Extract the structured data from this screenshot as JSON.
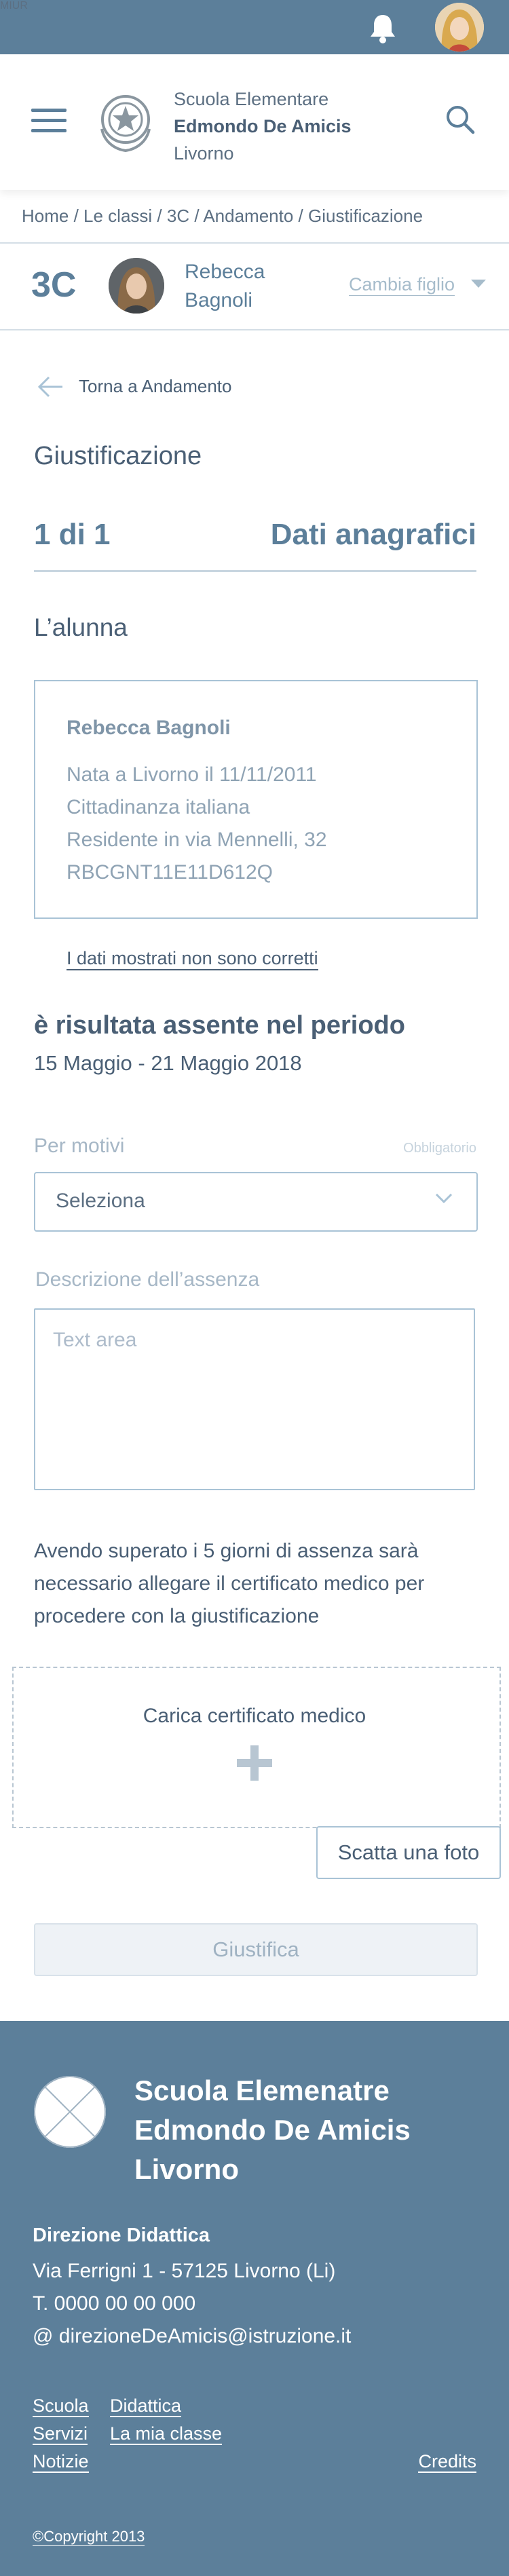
{
  "topbar": {
    "brand": "MIUR",
    "bell_icon": "bell-icon",
    "avatar_icon": "user-avatar"
  },
  "header": {
    "menu_icon": "hamburger-menu-icon",
    "school_line1": "Scuola Elementare",
    "school_line2": "Edmondo De Amicis",
    "school_line3": "Livorno",
    "search_icon": "search-icon"
  },
  "breadcrumb": "Home / Le classi / 3C / Andamento / Giustificazione",
  "classbar": {
    "class_code": "3C",
    "student_line1": "Rebecca",
    "student_line2": "Bagnoli",
    "change_child": "Cambia figlio"
  },
  "main": {
    "back_label": "Torna a Andamento",
    "page_title": "Giustificazione",
    "step": "1 di 1",
    "step_title": "Dati anagrafici",
    "section_title": "L’alunna",
    "info": {
      "name": "Rebecca Bagnoli",
      "birth": "Nata a Livorno il 11/11/2011",
      "citizenship": "Cittadinanza italiana",
      "address": "Residente in via Mennelli, 32",
      "fiscal_code": "RBCGNT11E11D612Q"
    },
    "wrong_data_link": "I dati mostrati non sono corretti",
    "absent_title": "è risultata assente nel periodo",
    "absent_period": "15 Maggio - 21 Maggio 2018",
    "reasons_label": "Per motivi",
    "required_label": "Obbligatorio",
    "reasons_value": "Seleziona",
    "description_label": "Descrizione dell’assenza",
    "description_placeholder": "Text area",
    "notice": "Avendo superato i 5 giorni di assenza sarà necessario allegare il certificato medico per procedere con la giustificazione",
    "upload_label": "Carica certificato medico",
    "photo_button": "Scatta una foto",
    "submit_button": "Giustifica"
  },
  "footer": {
    "school_line1": "Scuola Elemenatre",
    "school_line2": "Edmondo De Amicis",
    "school_line3": "Livorno",
    "direction_title": "Direzione Didattica",
    "address": "Via Ferrigni 1 - 57125 Livorno (Li)",
    "phone": "T. 0000 00 00 000",
    "email": "@ direzioneDeAmicis@istruzione.it",
    "links": {
      "scuola": "Scuola",
      "didattica": "Didattica",
      "servizi": "Servizi",
      "la_mia_classe": "La mia classe",
      "notizie": "Notizie",
      "credits": "Credits"
    },
    "copyright": "©Copyright 2013"
  },
  "colors": {
    "primary": "#5c7f9a",
    "text": "#4a5f75",
    "border": "#a9c3d6"
  }
}
